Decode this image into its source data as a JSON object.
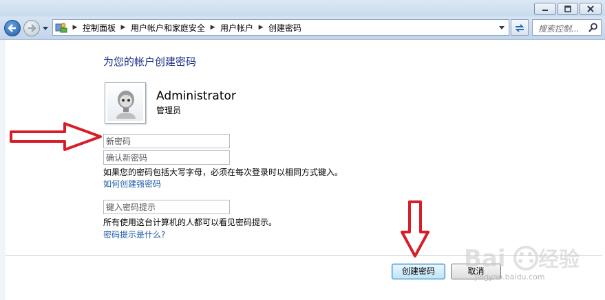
{
  "breadcrumb": [
    "控制面板",
    "用户帐户和家庭安全",
    "用户帐户",
    "创建密码"
  ],
  "search": {
    "placeholder": "搜索控制..."
  },
  "page": {
    "title": "为您的帐户创建密码"
  },
  "user": {
    "name": "Administrator",
    "role": "管理员"
  },
  "form": {
    "new_password_placeholder": "新密码",
    "confirm_password_placeholder": "确认新密码",
    "case_note": "如果您的密码包括大写字母，必须在每次登录时以相同方式键入。",
    "strong_password_link": "如何创建强密码",
    "hint_placeholder": "键入密码提示",
    "hint_note": "所有使用这台计算机的人都可以看见密码提示。",
    "hint_link": "密码提示是什么?"
  },
  "buttons": {
    "create": "创建密码",
    "cancel": "取消"
  },
  "watermark": {
    "url": "jingyan.baidu.com"
  },
  "colors": {
    "arrow": "#d71e28",
    "link": "#1c5aa6",
    "title": "#1e3287"
  }
}
